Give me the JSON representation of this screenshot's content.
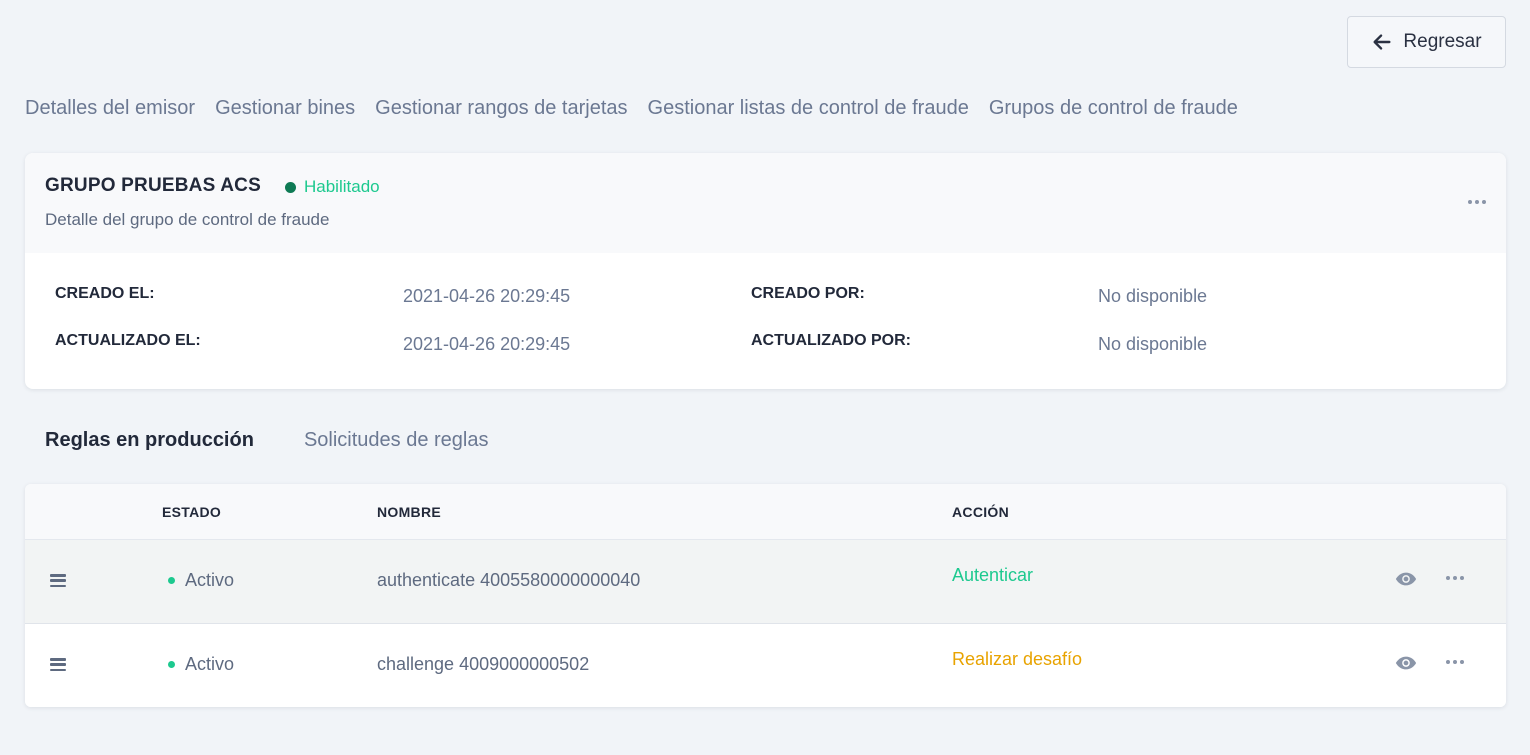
{
  "header": {
    "back_label": "Regresar"
  },
  "nav": [
    {
      "label": "Detalles del emisor"
    },
    {
      "label": "Gestionar bines"
    },
    {
      "label": "Gestionar rangos de tarjetas"
    },
    {
      "label": "Gestionar listas de control de fraude"
    },
    {
      "label": "Grupos de control de fraude"
    }
  ],
  "group": {
    "title": "GRUPO PRUEBAS ACS",
    "status": "Habilitado",
    "subtitle": "Detalle del grupo de control de fraude",
    "meta": {
      "created_at_label": "CREADO EL:",
      "created_at": "2021-04-26 20:29:45",
      "created_by_label": "CREADO POR:",
      "created_by": "No disponible",
      "updated_at_label": "ACTUALIZADO EL:",
      "updated_at": "2021-04-26 20:29:45",
      "updated_by_label": "ACTUALIZADO POR:",
      "updated_by": "No disponible"
    }
  },
  "tabs": [
    {
      "label": "Reglas en producción",
      "active": true
    },
    {
      "label": "Solicitudes de reglas",
      "active": false
    }
  ],
  "table": {
    "columns": {
      "status": "ESTADO",
      "name": "NOMBRE",
      "action": "ACCIÓN"
    },
    "rows": [
      {
        "status": "Activo",
        "name": "authenticate 4005580000000040",
        "action": "Autenticar",
        "action_color": "#1dc98f"
      },
      {
        "status": "Activo",
        "name": "challenge 4009000000502",
        "action": "Realizar desafío",
        "action_color": "#e8a300"
      }
    ]
  },
  "colors": {
    "accent_green": "#1dc98f",
    "status_dot_dark": "#0e7a54",
    "warning_amber": "#e8a300",
    "background": "#f1f4f8"
  },
  "icons": {
    "back": "arrow-left-icon",
    "menu": "more-horizontal-icon",
    "drag": "drag-handle-icon",
    "view": "eye-icon"
  }
}
